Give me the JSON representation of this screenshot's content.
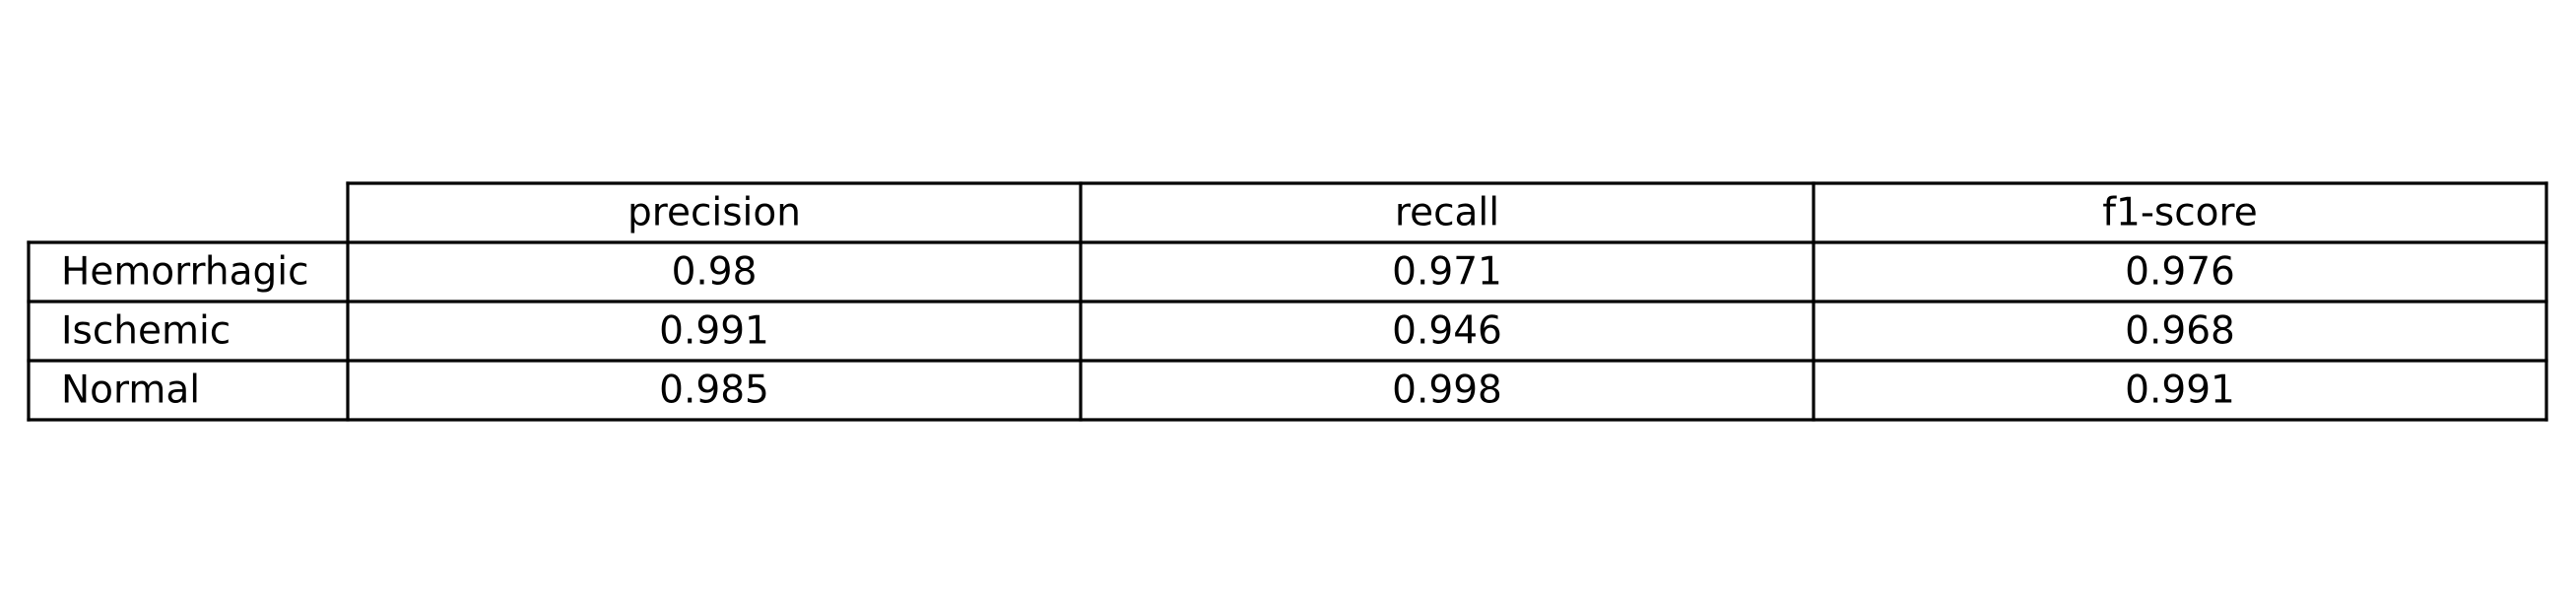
{
  "chart_data": {
    "type": "table",
    "columns": [
      "precision",
      "recall",
      "f1-score"
    ],
    "rows": [
      {
        "label": "Hemorrhagic",
        "values": [
          "0.98",
          "0.971",
          "0.976"
        ]
      },
      {
        "label": "Ischemic",
        "values": [
          "0.991",
          "0.946",
          "0.968"
        ]
      },
      {
        "label": "Normal",
        "values": [
          "0.985",
          "0.998",
          "0.991"
        ]
      }
    ]
  }
}
